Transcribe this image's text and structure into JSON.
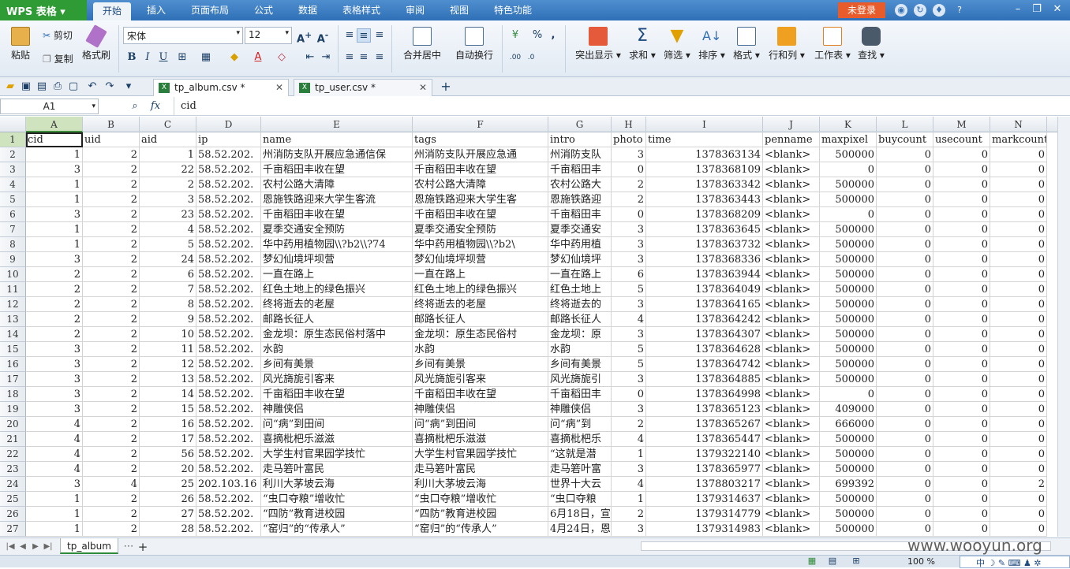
{
  "titlebar": {
    "app_menu": "WPS 表格",
    "tabs": [
      "开始",
      "插入",
      "页面布局",
      "公式",
      "数据",
      "表格样式",
      "审阅",
      "视图",
      "特色功能"
    ],
    "active_tab": 0,
    "login": "未登录",
    "help": "?"
  },
  "ribbon": {
    "paste": "粘贴",
    "cut": "剪切",
    "copy": "复制",
    "format_painter": "格式刷",
    "font_name": "宋体",
    "font_size": "12",
    "bold": "B",
    "italic": "I",
    "underline": "U",
    "merge_center": "合并居中",
    "wrap_text": "自动换行",
    "percent": "%",
    "comma": ",",
    "highlight": "突出显示",
    "sum": "求和",
    "filter": "筛选",
    "sort": "排序",
    "format": "格式",
    "row_col": "行和列",
    "worksheet": "工作表",
    "find": "查找"
  },
  "doc_tabs": [
    {
      "label": "tp_album.csv *",
      "active": true
    },
    {
      "label": "tp_user.csv *",
      "active": false
    }
  ],
  "formula_bar": {
    "cell_ref": "A1",
    "fx": "fx",
    "content": "cid"
  },
  "columns": [
    "A",
    "B",
    "C",
    "D",
    "E",
    "F",
    "G",
    "H",
    "I",
    "J",
    "K",
    "L",
    "M",
    "N"
  ],
  "header_row": [
    "cid",
    "uid",
    "aid",
    "ip",
    "name",
    "tags",
    "intro",
    "photo",
    "time",
    "penname",
    "maxpixel",
    "buycount",
    "usecount",
    "markcount"
  ],
  "rows": [
    [
      "1",
      "2",
      "1",
      "58.52.202.",
      "州消防支队开展应急通信保",
      "州消防支队开展应急通",
      "州消防支队",
      "3",
      "1378363134",
      "<blank>",
      "500000",
      "0",
      "0",
      "0"
    ],
    [
      "3",
      "2",
      "22",
      "58.52.202.",
      "千亩稻田丰收在望",
      "千亩稻田丰收在望",
      "千亩稻田丰",
      "0",
      "1378368109",
      "<blank>",
      "0",
      "0",
      "0",
      "0"
    ],
    [
      "1",
      "2",
      "2",
      "58.52.202.",
      "农村公路大清障",
      "农村公路大清障",
      "农村公路大",
      "2",
      "1378363342",
      "<blank>",
      "500000",
      "0",
      "0",
      "0"
    ],
    [
      "1",
      "2",
      "3",
      "58.52.202.",
      "恩施铁路迎来大学生客流",
      "恩施铁路迎来大学生客",
      "恩施铁路迎",
      "2",
      "1378363443",
      "<blank>",
      "500000",
      "0",
      "0",
      "0"
    ],
    [
      "3",
      "2",
      "23",
      "58.52.202.",
      "千亩稻田丰收在望",
      "千亩稻田丰收在望",
      "千亩稻田丰",
      "0",
      "1378368209",
      "<blank>",
      "0",
      "0",
      "0",
      "0"
    ],
    [
      "1",
      "2",
      "4",
      "58.52.202.",
      "夏季交通安全预防",
      "夏季交通安全预防",
      "夏季交通安",
      "3",
      "1378363645",
      "<blank>",
      "500000",
      "0",
      "0",
      "0"
    ],
    [
      "1",
      "2",
      "5",
      "58.52.202.",
      "华中药用植物园\\\\?b2\\\\?74",
      "华中药用植物园\\\\?b2\\",
      "华中药用植",
      "3",
      "1378363732",
      "<blank>",
      "500000",
      "0",
      "0",
      "0"
    ],
    [
      "3",
      "2",
      "24",
      "58.52.202.",
      "梦幻仙境坪坝营",
      "梦幻仙境坪坝营",
      "梦幻仙境坪",
      "3",
      "1378368336",
      "<blank>",
      "500000",
      "0",
      "0",
      "0"
    ],
    [
      "2",
      "2",
      "6",
      "58.52.202.",
      "一直在路上",
      "一直在路上",
      "一直在路上",
      "6",
      "1378363944",
      "<blank>",
      "500000",
      "0",
      "0",
      "0"
    ],
    [
      "2",
      "2",
      "7",
      "58.52.202.",
      "红色土地上的绿色振兴",
      "红色土地上的绿色振兴",
      "红色土地上",
      "5",
      "1378364049",
      "<blank>",
      "500000",
      "0",
      "0",
      "0"
    ],
    [
      "2",
      "2",
      "8",
      "58.52.202.",
      "终将逝去的老屋",
      "终将逝去的老屋",
      "终将逝去的",
      "3",
      "1378364165",
      "<blank>",
      "500000",
      "0",
      "0",
      "0"
    ],
    [
      "2",
      "2",
      "9",
      "58.52.202.",
      "邮路长征人",
      "邮路长征人",
      "邮路长征人",
      "4",
      "1378364242",
      "<blank>",
      "500000",
      "0",
      "0",
      "0"
    ],
    [
      "2",
      "2",
      "10",
      "58.52.202.",
      "金龙坝：原生态民俗村落中",
      "金龙坝：原生态民俗村",
      "金龙坝：原",
      "3",
      "1378364307",
      "<blank>",
      "500000",
      "0",
      "0",
      "0"
    ],
    [
      "3",
      "2",
      "11",
      "58.52.202.",
      "水韵",
      "水韵",
      "水韵",
      "5",
      "1378364628",
      "<blank>",
      "500000",
      "0",
      "0",
      "0"
    ],
    [
      "3",
      "2",
      "12",
      "58.52.202.",
      "乡间有美景",
      "乡间有美景",
      "乡间有美景",
      "5",
      "1378364742",
      "<blank>",
      "500000",
      "0",
      "0",
      "0"
    ],
    [
      "3",
      "2",
      "13",
      "58.52.202.",
      "风光旖旎引客来",
      "风光旖旎引客来",
      "风光旖旎引",
      "3",
      "1378364885",
      "<blank>",
      "500000",
      "0",
      "0",
      "0"
    ],
    [
      "3",
      "2",
      "14",
      "58.52.202.",
      "千亩稻田丰收在望",
      "千亩稻田丰收在望",
      "千亩稻田丰",
      "0",
      "1378364998",
      "<blank>",
      "0",
      "0",
      "0",
      "0"
    ],
    [
      "3",
      "2",
      "15",
      "58.52.202.",
      "神雕侠侣",
      "神雕侠侣",
      "神雕侠侣",
      "3",
      "1378365123",
      "<blank>",
      "409000",
      "0",
      "0",
      "0"
    ],
    [
      "4",
      "2",
      "16",
      "58.52.202.",
      "问“病”到田间",
      "问“病”到田间",
      "问“病”到",
      "2",
      "1378365267",
      "<blank>",
      "666000",
      "0",
      "0",
      "0"
    ],
    [
      "4",
      "2",
      "17",
      "58.52.202.",
      "喜摘枇杷乐滋滋",
      "喜摘枇杷乐滋滋",
      "喜摘枇杷乐",
      "4",
      "1378365447",
      "<blank>",
      "500000",
      "0",
      "0",
      "0"
    ],
    [
      "4",
      "2",
      "56",
      "58.52.202.",
      "大学生村官果园学技忙",
      "大学生村官果园学技忙",
      "“这就是潜",
      "1",
      "1379322140",
      "<blank>",
      "500000",
      "0",
      "0",
      "0"
    ],
    [
      "4",
      "2",
      "20",
      "58.52.202.",
      "走马箬叶富民",
      "走马箬叶富民",
      "走马箬叶富",
      "3",
      "1378365977",
      "<blank>",
      "500000",
      "0",
      "0",
      "0"
    ],
    [
      "3",
      "4",
      "25",
      "202.103.16",
      "利川大茅坡云海",
      "利川大茅坡云海",
      "世界十大云",
      "4",
      "1378803217",
      "<blank>",
      "699392",
      "0",
      "0",
      "2"
    ],
    [
      "1",
      "2",
      "26",
      "58.52.202.",
      "“虫口夺粮”增收忙",
      "“虫口夺粮”增收忙",
      "“虫口夺粮",
      "1",
      "1379314637",
      "<blank>",
      "500000",
      "0",
      "0",
      "0"
    ],
    [
      "1",
      "2",
      "27",
      "58.52.202.",
      "“四防”教育进校园",
      "“四防”教育进校园",
      "6月18日，宣",
      "2",
      "1379314779",
      "<blank>",
      "500000",
      "0",
      "0",
      "0"
    ],
    [
      "1",
      "2",
      "28",
      "58.52.202.",
      "“窑归”的“传承人”",
      "“窑归”的“传承人”",
      "4月24日，恩",
      "3",
      "1379314983",
      "<blank>",
      "500000",
      "0",
      "0",
      "0"
    ]
  ],
  "sheet_tabs": [
    "tp_album"
  ],
  "status": {
    "zoom": "100 %"
  },
  "watermark": "www.wooyun.org",
  "ime": "中"
}
